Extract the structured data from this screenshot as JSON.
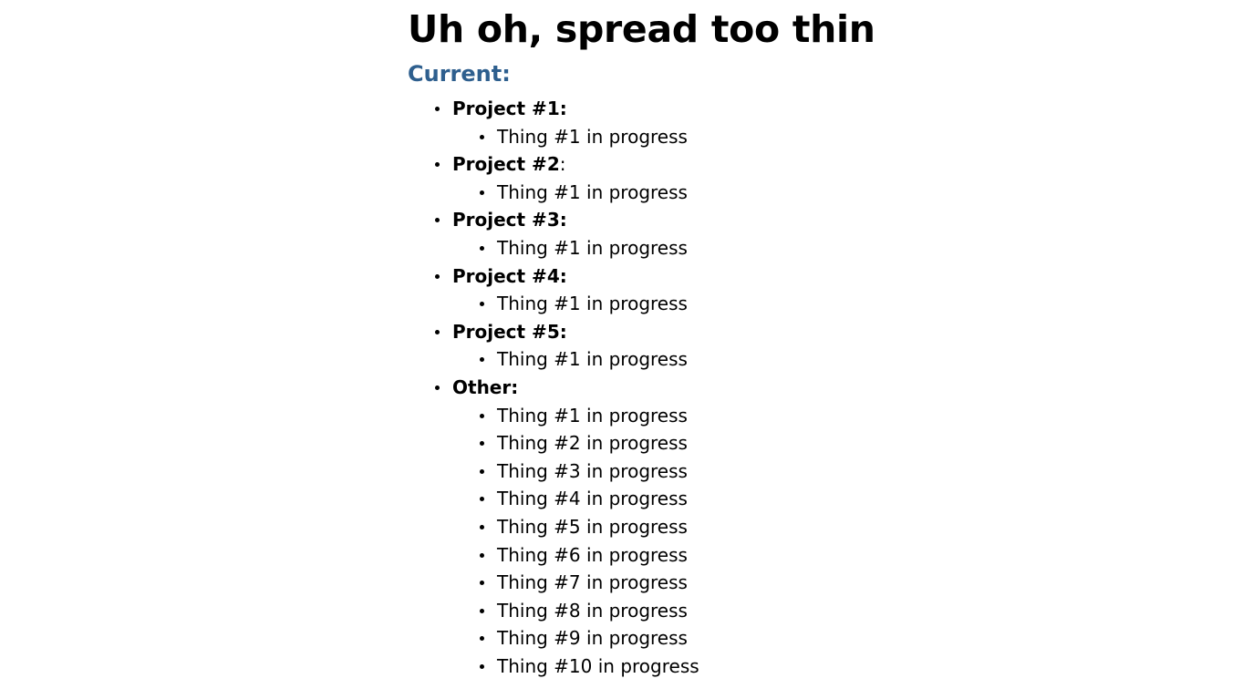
{
  "slide": {
    "title": "Uh oh, spread too thin",
    "subtitle": "Current:",
    "projects": [
      {
        "name": "Project #1:",
        "suffix": "",
        "items": [
          "Thing #1 in progress"
        ]
      },
      {
        "name": "Project #2",
        "suffix": ":",
        "items": [
          "Thing #1 in progress"
        ]
      },
      {
        "name": "Project #3:",
        "suffix": "",
        "items": [
          "Thing #1 in progress"
        ]
      },
      {
        "name": "Project #4:",
        "suffix": "",
        "items": [
          "Thing #1 in progress"
        ]
      },
      {
        "name": "Project #5:",
        "suffix": "",
        "items": [
          "Thing #1 in progress"
        ]
      },
      {
        "name": "Other:",
        "suffix": "",
        "items": [
          "Thing #1 in progress",
          "Thing #2 in progress",
          "Thing #3 in progress",
          "Thing #4 in progress",
          "Thing #5 in progress",
          "Thing #6 in progress",
          "Thing #7 in progress",
          "Thing #8 in progress",
          "Thing #9 in progress",
          "Thing #10 in progress"
        ]
      }
    ]
  }
}
